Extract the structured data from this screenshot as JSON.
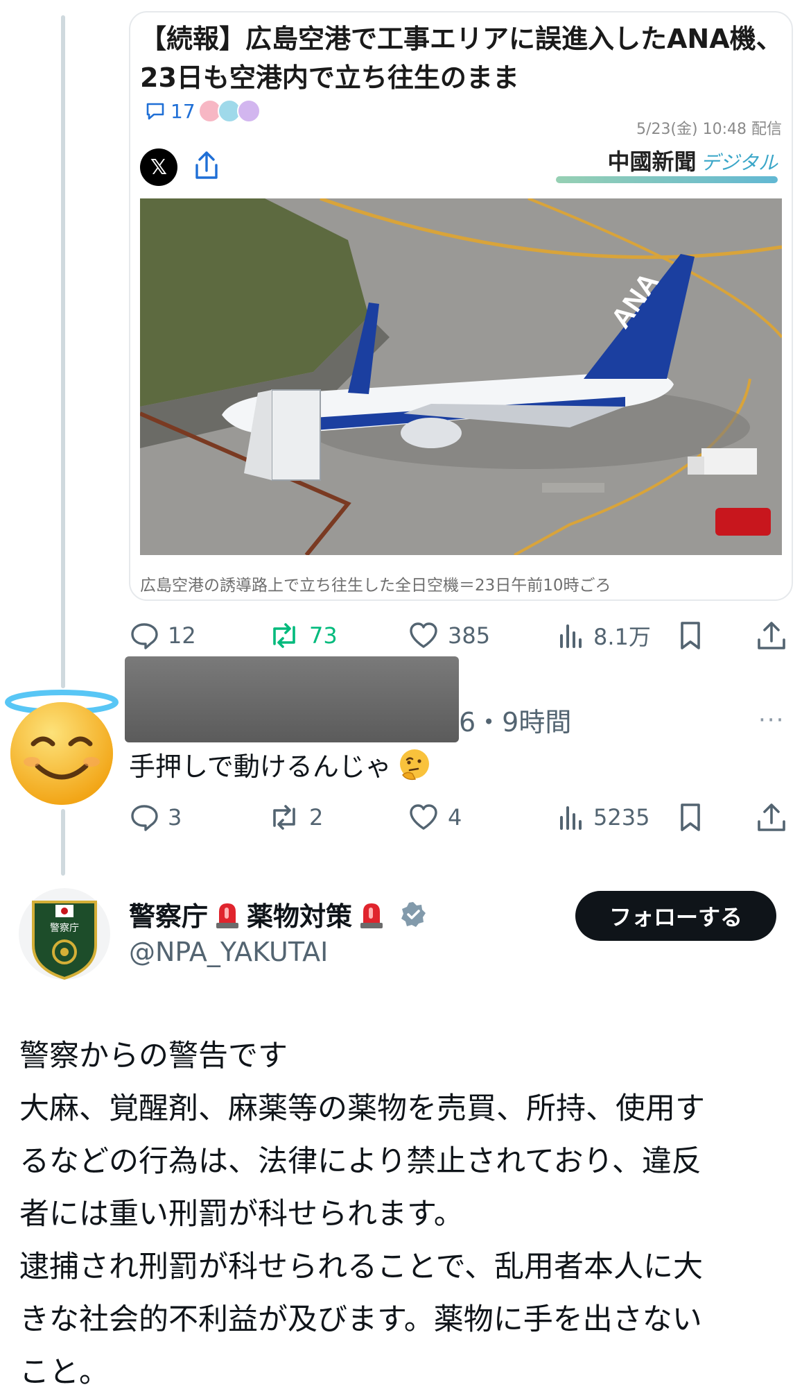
{
  "quoted_card": {
    "title": "【続報】広島空港で工事エリアに誤進入したANA機、23日も空港内で立ち往生のまま",
    "comment_count": "17",
    "date": "5/23(金) 10:48 配信",
    "x_label": "𝕏",
    "publisher_main": "中國新聞",
    "publisher_sub": "デジタル",
    "photo_tail_text": "ANA",
    "caption": "広島空港の誘導路上で立ち往生した全日空機＝23日午前10時ごろ"
  },
  "quote_actions": {
    "replies": "12",
    "reposts": "73",
    "likes": "385",
    "views": "8.1万"
  },
  "reply": {
    "time": "6・9時間",
    "more": "···",
    "text": "手押しで動けるんじゃ"
  },
  "reply_actions": {
    "replies": "3",
    "reposts": "2",
    "likes": "4",
    "views": "5235"
  },
  "account": {
    "name_part1": "警察庁",
    "name_part2": "薬物対策",
    "handle": "@NPA_YAKUTAI",
    "follow_label": "フォローする",
    "emblem_text": "警察庁"
  },
  "post_lines": [
    "警察からの警告です",
    "大麻、覚醒剤、麻薬等の薬物を売買、所持、使用す",
    "るなどの行為は、法律により禁止されており、違反",
    "者には重い刑罰が科せられます。",
    "逮捕され刑罰が科せられることで、乱用者本人に大",
    "きな社会的不利益が及びます。薬物に手を出さない",
    "こと。"
  ],
  "colors": {
    "accent_blue": "#1f6fd6",
    "repost_green": "#00ba7c",
    "muted": "#536471",
    "thread_line": "#cfd9de"
  },
  "icons": [
    "comment-icon",
    "x-logo-icon",
    "share-icon",
    "reply-icon",
    "repost-icon",
    "like-icon",
    "views-icon",
    "bookmark-icon",
    "upload-icon",
    "more-icon",
    "siren-icon",
    "verified-icon",
    "thinking-emoji-icon",
    "halo-smile-emoji-icon"
  ]
}
